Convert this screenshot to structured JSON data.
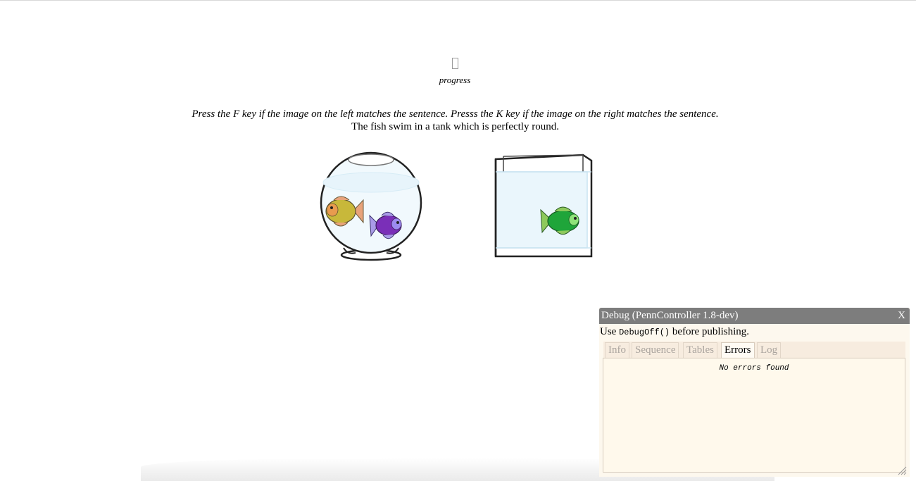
{
  "progress": {
    "label": "progress"
  },
  "trial": {
    "instructions": "Press the F key if the image on the left matches the sentence. Presss the K key if the image on the right matches the sentence.",
    "sentence": "The fish swim in a tank which is perfectly round."
  },
  "debug": {
    "title": "Debug (PennController 1.8-dev)",
    "close_label": "X",
    "note_prefix": "Use",
    "note_code": "DebugOff()",
    "note_suffix": "before publishing.",
    "tabs": [
      {
        "label": "Info",
        "active": false
      },
      {
        "label": "Sequence",
        "active": false
      },
      {
        "label": "Tables",
        "active": false
      },
      {
        "label": "Errors",
        "active": true
      },
      {
        "label": "Log",
        "active": false
      }
    ],
    "errors_message": "No errors found"
  },
  "colors": {
    "debug_header": "#7d7d7d",
    "debug_bg": "#fdf8ee",
    "tab_bar": "#f7ecdf"
  }
}
